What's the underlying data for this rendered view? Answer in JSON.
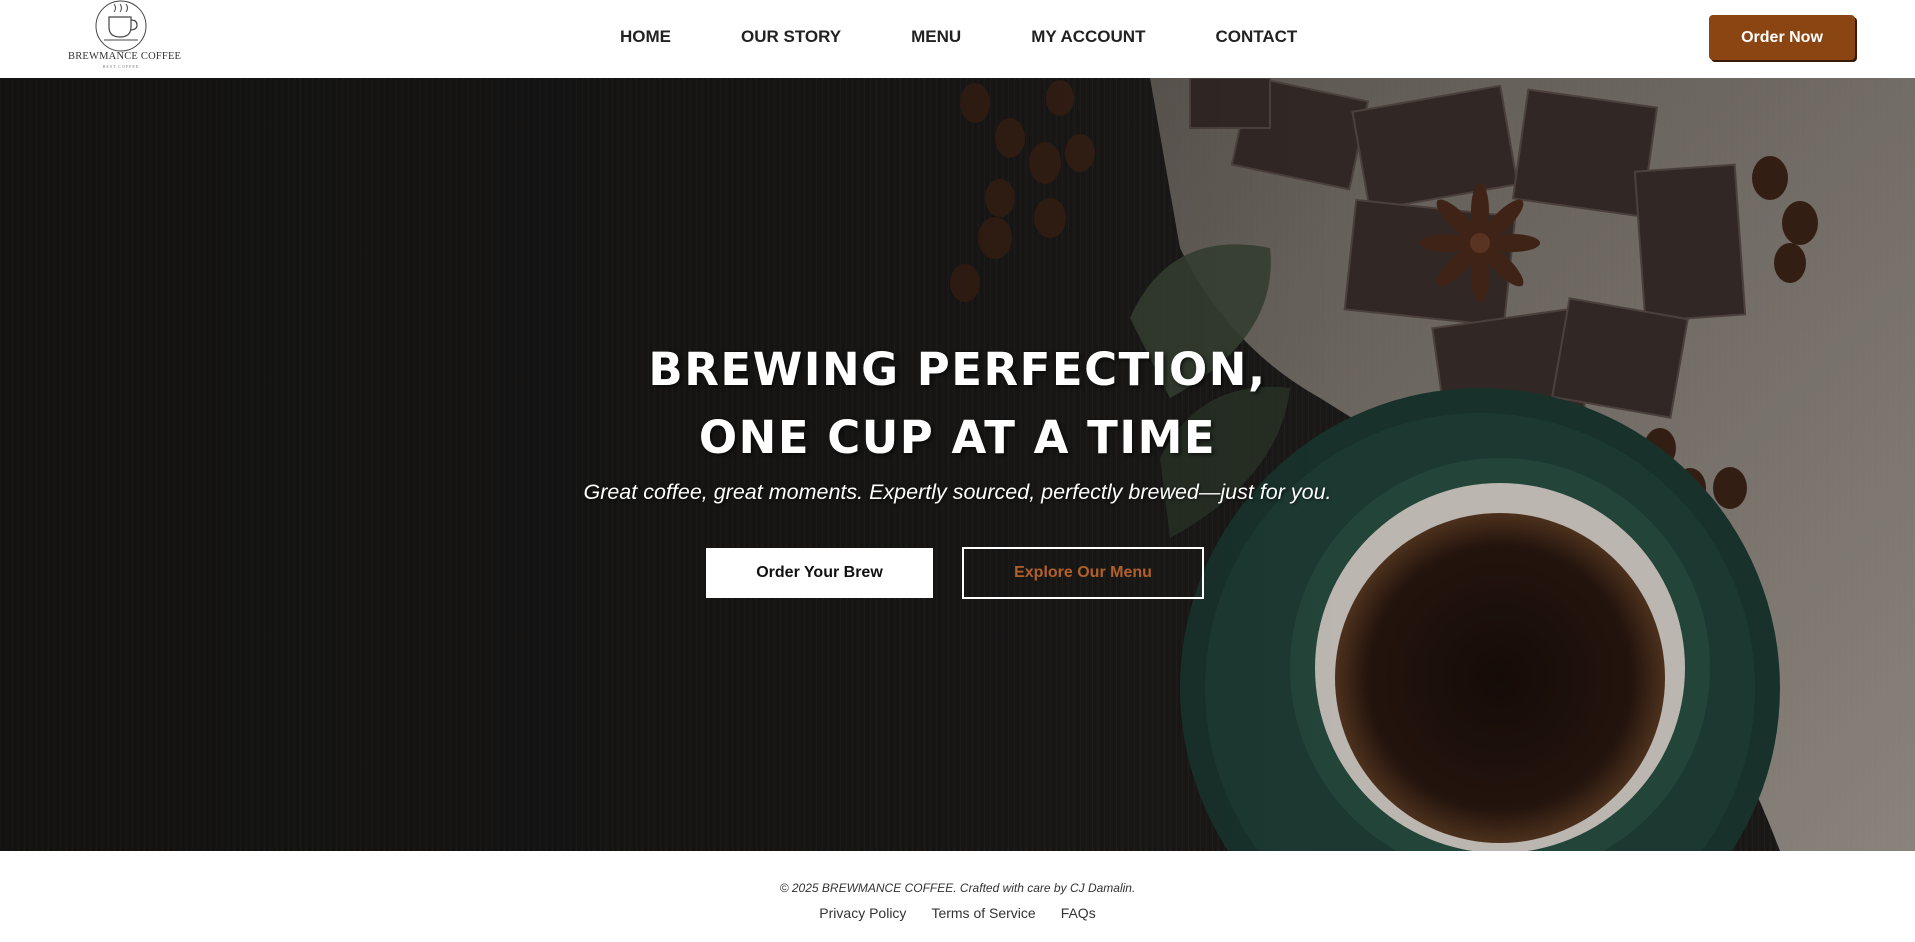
{
  "brand": {
    "name": "BREWMANCE COFFEE",
    "tagline": "BEST COFFEE",
    "logo_icon": "coffee-cup-icon"
  },
  "nav": {
    "items": [
      "HOME",
      "OUR STORY",
      "MENU",
      "MY ACCOUNT",
      "CONTACT"
    ]
  },
  "header": {
    "cta_label": "Order Now"
  },
  "hero": {
    "title_line1": "BREWING PERFECTION,",
    "title_line2": "ONE CUP AT A TIME",
    "subtitle": "Great coffee, great moments. Expertly sourced, perfectly brewed—just for you.",
    "primary_button": "Order Your Brew",
    "secondary_button": "Explore Our Menu"
  },
  "footer": {
    "copyright": "© 2025 BREWMANCE COFFEE. Crafted with care by CJ Damalin.",
    "links": [
      "Privacy Policy",
      "Terms of Service",
      "FAQs"
    ]
  },
  "colors": {
    "accent": "#8b4513",
    "secondary_text": "#b0602a",
    "hero_background": "#1d1c1b"
  }
}
